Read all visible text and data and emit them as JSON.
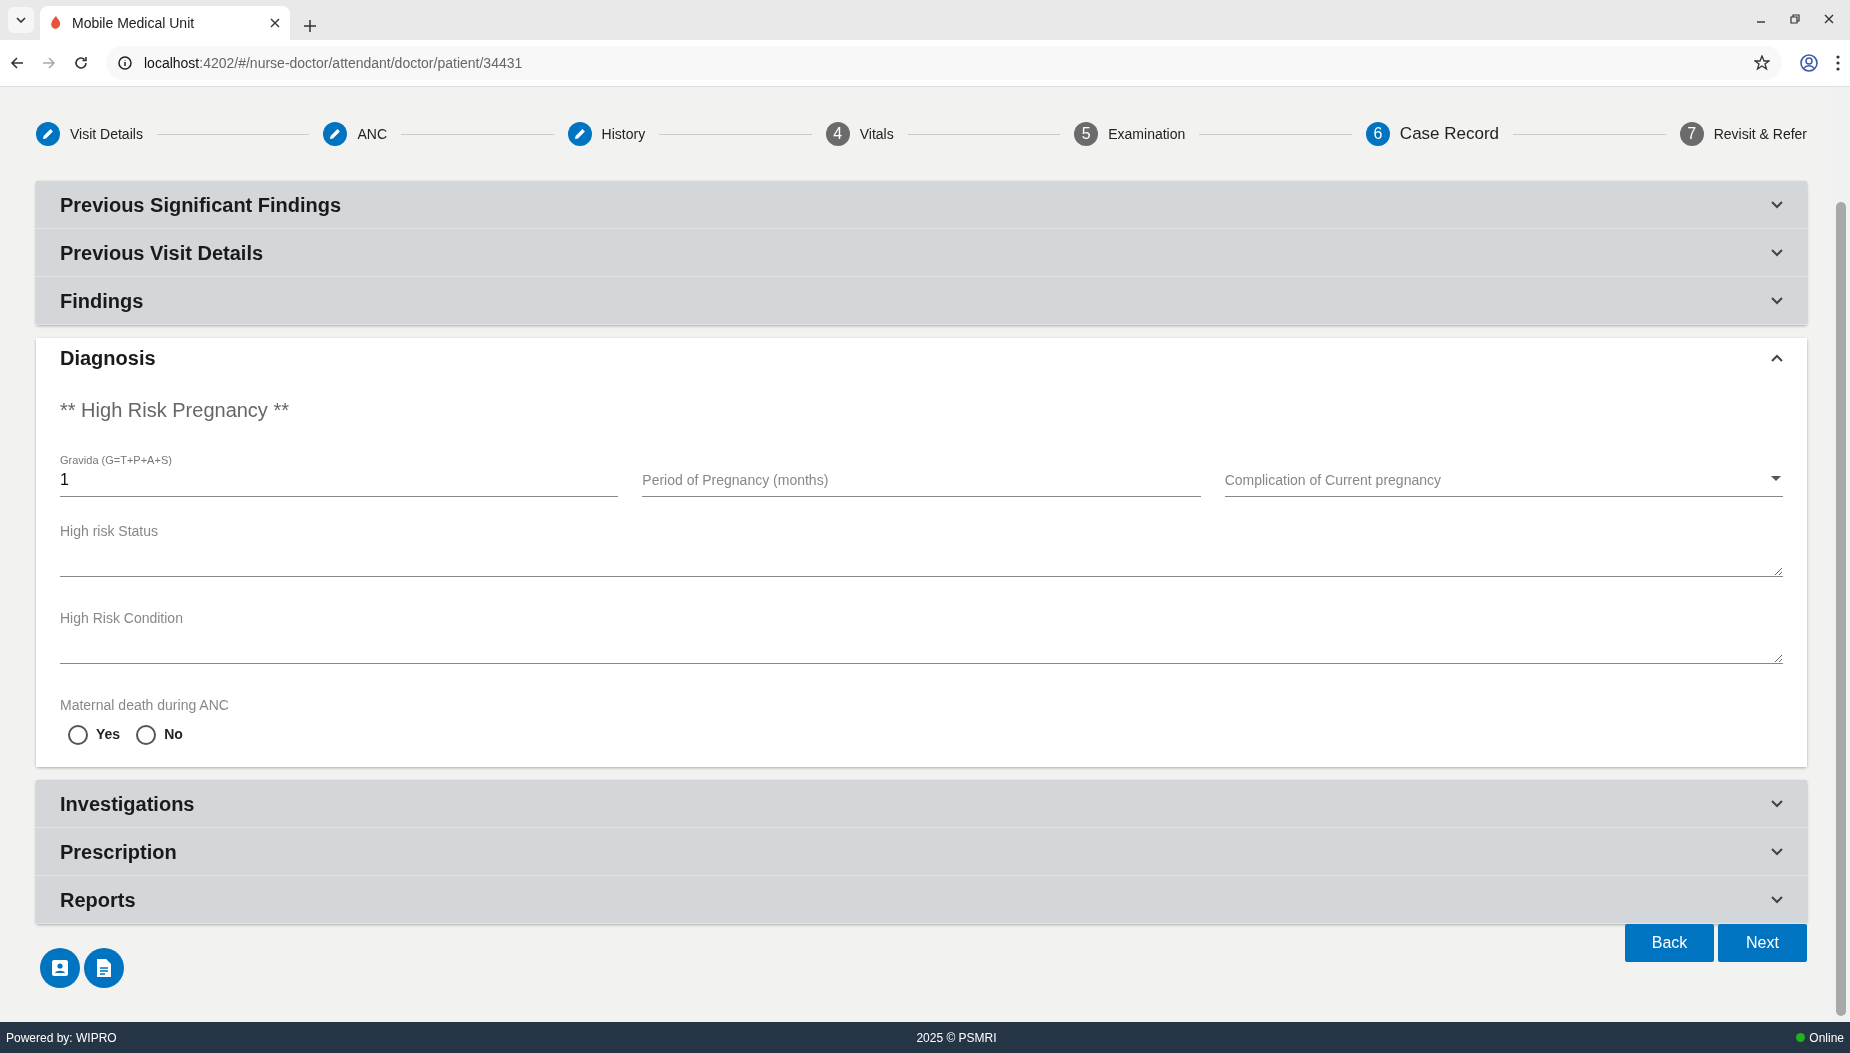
{
  "browser": {
    "tab_title": "Mobile Medical Unit",
    "url_host": "localhost",
    "url_path": ":4202/#/nurse-doctor/attendant/doctor/patient/34431"
  },
  "steps": [
    {
      "label": "Visit Details",
      "completed": true,
      "selected": false
    },
    {
      "label": "ANC",
      "completed": true,
      "selected": false
    },
    {
      "label": "History",
      "completed": true,
      "selected": false
    },
    {
      "number": "4",
      "label": "Vitals",
      "completed": false,
      "selected": false
    },
    {
      "number": "5",
      "label": "Examination",
      "completed": false,
      "selected": false
    },
    {
      "number": "6",
      "label": "Case Record",
      "completed": false,
      "selected": true
    },
    {
      "number": "7",
      "label": "Revisit & Refer",
      "completed": false,
      "selected": false
    }
  ],
  "sections": [
    {
      "title": "Previous Significant Findings",
      "expanded": false
    },
    {
      "title": "Previous Visit Details",
      "expanded": false
    },
    {
      "title": "Findings",
      "expanded": false
    },
    {
      "title": "Diagnosis",
      "expanded": true,
      "heading": "** High Risk Pregnancy **",
      "fields": [
        {
          "kind": "input",
          "label": "Gravida (G=T+P+A+S)",
          "value": "1"
        },
        {
          "kind": "input",
          "placeholder": "Period of Pregnancy (months)"
        },
        {
          "kind": "select",
          "placeholder": "Complication of Current pregnancy"
        },
        {
          "kind": "textarea",
          "placeholder": "High risk Status"
        },
        {
          "kind": "textarea",
          "placeholder": "High Risk Condition"
        }
      ],
      "radio_group": {
        "label": "Maternal death during ANC",
        "options": [
          {
            "label": "Yes",
            "selected": false
          },
          {
            "label": "No",
            "selected": false
          }
        ]
      }
    },
    {
      "title": "Investigations",
      "expanded": false
    },
    {
      "title": "Prescription",
      "expanded": false
    },
    {
      "title": "Reports",
      "expanded": false
    }
  ],
  "buttons": [
    "Back",
    "Next"
  ],
  "footer": {
    "left": "Powered by: WIPRO",
    "center": "2025 © PSMRI",
    "status": "Online"
  }
}
